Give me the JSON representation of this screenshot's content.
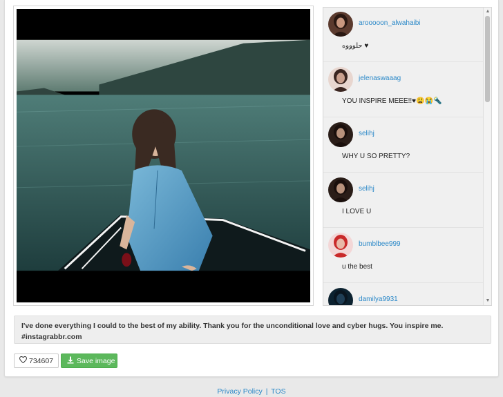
{
  "post": {
    "caption_line1": "I've done everything I could to the best of my ability. Thank you for the unconditional love and cyber hugs. You inspire me.",
    "caption_line2": "#instagrabbr.com",
    "likes": "734607",
    "save_label": "Save image"
  },
  "comments": [
    {
      "username": "arooooon_alwahaibi",
      "text": "حلوووه ♥"
    },
    {
      "username": "jelenaswaaag",
      "text": "YOU INSPIRE MEEE!!♥😩😭🔦"
    },
    {
      "username": "selihj",
      "text": "WHY U SO PRETTY?"
    },
    {
      "username": "selihj",
      "text": "I LOVE U"
    },
    {
      "username": "bumblbee999",
      "text": "u the best"
    },
    {
      "username": "damilya9931",
      "text": ""
    }
  ],
  "footer": {
    "privacy": "Privacy Policy",
    "separator": "|",
    "tos": "TOS"
  },
  "colors": {
    "link": "#2a88c8",
    "save_button": "#5cb85c"
  },
  "icons": {
    "likes": "heart-icon",
    "save": "download-icon"
  }
}
